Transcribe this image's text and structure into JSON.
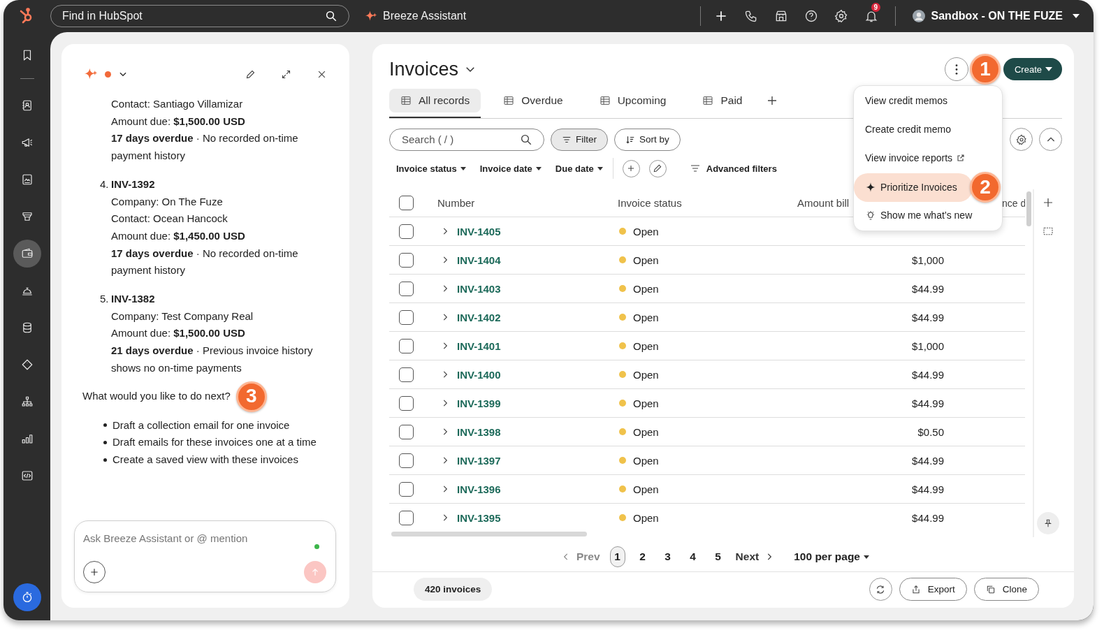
{
  "top_bar": {
    "search_placeholder": "Find in HubSpot",
    "assistant_label": "Breeze Assistant",
    "notification_count": "9",
    "account_name": "Sandbox - ON THE FUZE"
  },
  "sidebar": {
    "items": [
      {
        "kind": "bookmark",
        "selected": false
      },
      {
        "kind": "contacts",
        "selected": false
      },
      {
        "kind": "megaphone",
        "selected": false
      },
      {
        "kind": "content",
        "selected": false
      },
      {
        "kind": "store",
        "selected": false
      },
      {
        "kind": "wallet",
        "selected": true
      },
      {
        "kind": "bell",
        "selected": false
      },
      {
        "kind": "database",
        "selected": false
      },
      {
        "kind": "tag",
        "selected": false
      },
      {
        "kind": "org",
        "selected": false
      },
      {
        "kind": "chart",
        "selected": false
      },
      {
        "kind": "code",
        "selected": false
      }
    ]
  },
  "assistant": {
    "entries": [
      {
        "lines": [
          "Contact: Santiago Villamizar",
          "Amount due: **$1,500.00 USD**",
          "**17 days overdue** · No recorded on-time payment history"
        ]
      },
      {
        "marker": "4.",
        "title": "INV-1392",
        "lines": [
          "Company: On The Fuze",
          "Contact: Ocean Hancock",
          "Amount due: **$1,450.00 USD**",
          "**17 days overdue** · No recorded on-time payment history"
        ]
      },
      {
        "marker": "5.",
        "title": "INV-1382",
        "lines": [
          "Company: Test Company Real",
          "Amount due: **$1,500.00 USD**",
          "**21 days overdue** · Previous invoice history shows no on-time payments"
        ]
      }
    ],
    "question": "What would you like to do next?",
    "question_callout": "3",
    "suggestions": [
      "Draft a collection email for one invoice",
      "Draft emails for these invoices one at a time",
      "Create a saved view with these invoices"
    ],
    "input_placeholder": "Ask Breeze Assistant or @ mention",
    "send_disabled": true
  },
  "main": {
    "title": "Invoices",
    "views": [
      {
        "label": "All records",
        "selected": true
      },
      {
        "label": "Overdue",
        "selected": false
      },
      {
        "label": "Upcoming",
        "selected": false
      },
      {
        "label": "Paid",
        "selected": false
      }
    ],
    "search_placeholder": "Search ( / )",
    "filter": {
      "label": "Filter",
      "active": true
    },
    "sort_label": "Sort by",
    "create_label": "Create",
    "create_callout": "1",
    "filters": [
      "Invoice status",
      "Invoice date",
      "Due date"
    ],
    "advanced_filters": "Advanced filters",
    "menu": {
      "callout": "2",
      "items": [
        {
          "label": "View credit memos",
          "kind": "plain",
          "highlighted": false
        },
        {
          "label": "Create credit memo",
          "kind": "plain",
          "highlighted": false
        },
        {
          "label": "View invoice reports",
          "kind": "external",
          "highlighted": false
        },
        {
          "label": "Prioritize Invoices",
          "kind": "ai",
          "highlighted": true
        },
        {
          "label": "Show me what’s new",
          "kind": "tip",
          "highlighted": false
        }
      ]
    },
    "table": {
      "columns": [
        "Number",
        "Invoice status",
        "Amount bill",
        "nce d"
      ],
      "all_checked": false,
      "rows": [
        {
          "checked": false,
          "number": "INV-1405",
          "status": "Open"
        },
        {
          "checked": false,
          "number": "INV-1404",
          "status": "Open",
          "amount": "$1,000"
        },
        {
          "checked": false,
          "number": "INV-1403",
          "status": "Open",
          "amount": "$44.99"
        },
        {
          "checked": false,
          "number": "INV-1402",
          "status": "Open",
          "amount": "$44.99"
        },
        {
          "checked": false,
          "number": "INV-1401",
          "status": "Open",
          "amount": "$1,000"
        },
        {
          "checked": false,
          "number": "INV-1400",
          "status": "Open",
          "amount": "$44.99"
        },
        {
          "checked": false,
          "number": "INV-1399",
          "status": "Open",
          "amount": "$44.99"
        },
        {
          "checked": false,
          "number": "INV-1398",
          "status": "Open",
          "amount": "$0.50"
        },
        {
          "checked": false,
          "number": "INV-1397",
          "status": "Open",
          "amount": "$44.99"
        },
        {
          "checked": false,
          "number": "INV-1396",
          "status": "Open",
          "amount": "$44.99"
        },
        {
          "checked": false,
          "number": "INV-1395",
          "status": "Open",
          "amount": "$44.99"
        }
      ]
    },
    "pagination": {
      "prev": {
        "label": "Prev",
        "disabled": true
      },
      "pages": [
        {
          "label": "1",
          "selected": true
        },
        {
          "label": "2",
          "selected": false
        },
        {
          "label": "3",
          "selected": false
        },
        {
          "label": "4",
          "selected": false
        },
        {
          "label": "5",
          "selected": false
        }
      ],
      "next": {
        "label": "Next",
        "disabled": false
      },
      "per_page": "100 per page"
    },
    "footer": {
      "count": "420 invoices",
      "export": "Export",
      "clone": "Clone"
    }
  }
}
